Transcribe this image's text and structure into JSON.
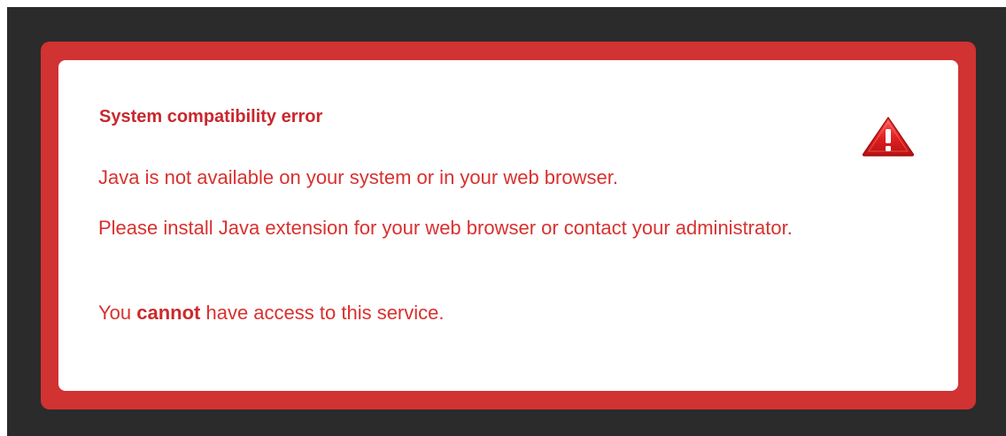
{
  "dialog": {
    "title": "System compatibility error",
    "line_1": "Java is not available on your system or in your web browser.",
    "line_2": "Please install Java extension for your web browser or contact your administrator.",
    "line_3_prefix": "You ",
    "line_3_emphasis": "cannot",
    "line_3_suffix": " have access to this service.",
    "icon": "warning-icon"
  },
  "colors": {
    "background": "#2b2b2b",
    "frame": "#d13232",
    "panel": "#ffffff",
    "text": "#d8312f"
  }
}
